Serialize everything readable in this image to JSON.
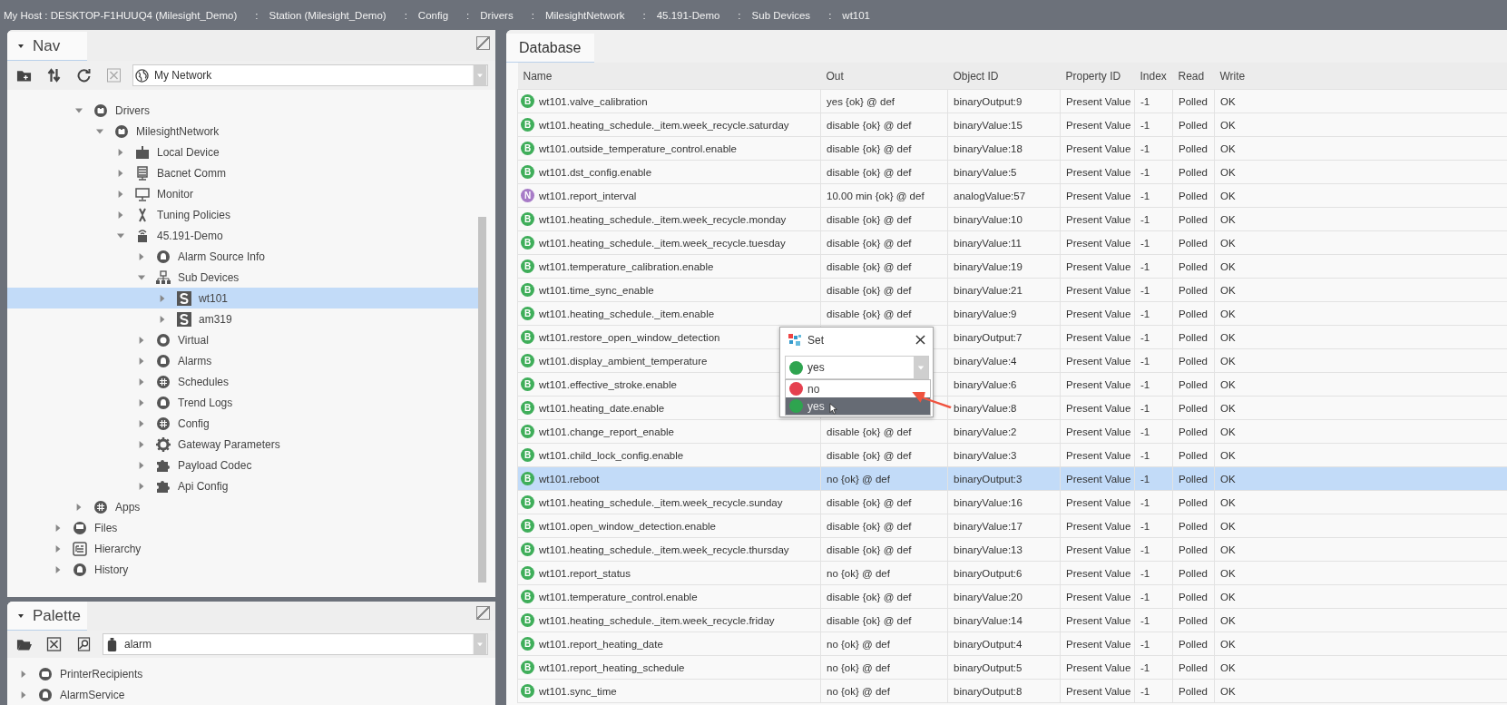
{
  "breadcrumb": {
    "separator": ":",
    "items": [
      "My Host : DESKTOP-F1HUUQ4 (Milesight_Demo)",
      "Station (Milesight_Demo)",
      "Config",
      "Drivers",
      "MilesightNetwork",
      "45.191-Demo",
      "Sub Devices",
      "wt101"
    ]
  },
  "nav": {
    "title": "Nav",
    "ord": "My Network",
    "tree": {
      "continued": [
        {
          "label": "Drivers",
          "kind": "driver",
          "expanded": true,
          "selected": false,
          "children": [
            {
              "label": "MilesightNetwork",
              "kind": "driver",
              "expanded": true,
              "selected": false,
              "children": [
                {
                  "label": "Local Device",
                  "kind": "device",
                  "expanded": false,
                  "selected": false
                },
                {
                  "label": "Bacnet Comm",
                  "kind": "server",
                  "expanded": false,
                  "selected": false
                },
                {
                  "label": "Monitor",
                  "kind": "monitor",
                  "expanded": false,
                  "selected": false
                },
                {
                  "label": "Tuning Policies",
                  "kind": "tool",
                  "expanded": false,
                  "selected": false
                },
                {
                  "label": "45.191-Demo",
                  "kind": "gateway",
                  "expanded": true,
                  "selected": false,
                  "children": [
                    {
                      "label": "Alarm Source Info",
                      "kind": "alarm",
                      "expanded": false,
                      "selected": false
                    },
                    {
                      "label": "Sub Devices",
                      "kind": "network",
                      "expanded": true,
                      "selected": false,
                      "children": [
                        {
                          "label": "wt101",
                          "kind": "subdevice",
                          "expanded": false,
                          "selected": true
                        },
                        {
                          "label": "am319",
                          "kind": "subdevice",
                          "expanded": false,
                          "selected": false
                        }
                      ]
                    },
                    {
                      "label": "Virtual",
                      "kind": "service",
                      "expanded": false,
                      "selected": false
                    },
                    {
                      "label": "Alarms",
                      "kind": "alarm",
                      "expanded": false,
                      "selected": false
                    },
                    {
                      "label": "Schedules",
                      "kind": "grid",
                      "expanded": false,
                      "selected": false
                    },
                    {
                      "label": "Trend Logs",
                      "kind": "alarm",
                      "expanded": false,
                      "selected": false
                    },
                    {
                      "label": "Config",
                      "kind": "grid",
                      "expanded": false,
                      "selected": false
                    },
                    {
                      "label": "Gateway Parameters",
                      "kind": "gear",
                      "expanded": false,
                      "selected": false
                    },
                    {
                      "label": "Payload Codec",
                      "kind": "puzzle",
                      "expanded": false,
                      "selected": false
                    },
                    {
                      "label": "Api Config",
                      "kind": "puzzle",
                      "expanded": false,
                      "selected": false
                    }
                  ]
                }
              ]
            }
          ]
        },
        {
          "label": "Apps",
          "kind": "grid",
          "expanded": false,
          "selected": false
        }
      ],
      "items": [
        {
          "label": "Files",
          "kind": "drive",
          "expanded": false,
          "selected": false
        },
        {
          "label": "Hierarchy",
          "kind": "list",
          "expanded": false,
          "selected": false
        },
        {
          "label": "History",
          "kind": "alarm",
          "expanded": false,
          "selected": false
        }
      ]
    }
  },
  "palette": {
    "title": "Palette",
    "module": "alarm",
    "items": [
      {
        "label": "PrinterRecipients",
        "kind": "folder",
        "expanded": false
      },
      {
        "label": "AlarmService",
        "kind": "alarm",
        "expanded": false
      }
    ]
  },
  "database": {
    "tab": "Database",
    "columns": [
      "Name",
      "Out",
      "Object ID",
      "Property ID",
      "Index",
      "Read",
      "Write"
    ],
    "rows": [
      {
        "type": "B",
        "color": "#3fae5a",
        "name": "wt101.valve_calibration",
        "out": "yes {ok} @ def",
        "object_id": "binaryOutput:9",
        "property_id": "Present Value",
        "index": "-1",
        "read": "Polled",
        "write": "OK",
        "selected": false
      },
      {
        "type": "B",
        "color": "#3fae5a",
        "name": "wt101.heating_schedule._item.week_recycle.saturday",
        "out": "disable {ok} @ def",
        "object_id": "binaryValue:15",
        "property_id": "Present Value",
        "index": "-1",
        "read": "Polled",
        "write": "OK",
        "selected": false
      },
      {
        "type": "B",
        "color": "#3fae5a",
        "name": "wt101.outside_temperature_control.enable",
        "out": "disable {ok} @ def",
        "object_id": "binaryValue:18",
        "property_id": "Present Value",
        "index": "-1",
        "read": "Polled",
        "write": "OK",
        "selected": false
      },
      {
        "type": "B",
        "color": "#3fae5a",
        "name": "wt101.dst_config.enable",
        "out": "disable {ok} @ def",
        "object_id": "binaryValue:5",
        "property_id": "Present Value",
        "index": "-1",
        "read": "Polled",
        "write": "OK",
        "selected": false
      },
      {
        "type": "N",
        "color": "#a77bc7",
        "name": "wt101.report_interval",
        "out": "10.00 min {ok} @ def",
        "object_id": "analogValue:57",
        "property_id": "Present Value",
        "index": "-1",
        "read": "Polled",
        "write": "OK",
        "selected": false
      },
      {
        "type": "B",
        "color": "#3fae5a",
        "name": "wt101.heating_schedule._item.week_recycle.monday",
        "out": "disable {ok} @ def",
        "object_id": "binaryValue:10",
        "property_id": "Present Value",
        "index": "-1",
        "read": "Polled",
        "write": "OK",
        "selected": false
      },
      {
        "type": "B",
        "color": "#3fae5a",
        "name": "wt101.heating_schedule._item.week_recycle.tuesday",
        "out": "disable {ok} @ def",
        "object_id": "binaryValue:11",
        "property_id": "Present Value",
        "index": "-1",
        "read": "Polled",
        "write": "OK",
        "selected": false
      },
      {
        "type": "B",
        "color": "#3fae5a",
        "name": "wt101.temperature_calibration.enable",
        "out": "disable {ok} @ def",
        "object_id": "binaryValue:19",
        "property_id": "Present Value",
        "index": "-1",
        "read": "Polled",
        "write": "OK",
        "selected": false
      },
      {
        "type": "B",
        "color": "#3fae5a",
        "name": "wt101.time_sync_enable",
        "out": "disable {ok} @ def",
        "object_id": "binaryValue:21",
        "property_id": "Present Value",
        "index": "-1",
        "read": "Polled",
        "write": "OK",
        "selected": false
      },
      {
        "type": "B",
        "color": "#3fae5a",
        "name": "wt101.heating_schedule._item.enable",
        "out": "disable {ok} @ def",
        "object_id": "binaryValue:9",
        "property_id": "Present Value",
        "index": "-1",
        "read": "Polled",
        "write": "OK",
        "selected": false
      },
      {
        "type": "B",
        "color": "#3fae5a",
        "name": "wt101.restore_open_window_detection",
        "object_id": "binaryOutput:7",
        "property_id": "Present Value",
        "index": "-1",
        "read": "Polled",
        "write": "OK",
        "selected": false
      },
      {
        "type": "B",
        "color": "#3fae5a",
        "name": "wt101.display_ambient_temperature",
        "object_id": "binaryValue:4",
        "property_id": "Present Value",
        "index": "-1",
        "read": "Polled",
        "write": "OK",
        "selected": false
      },
      {
        "type": "B",
        "color": "#3fae5a",
        "name": "wt101.effective_stroke.enable",
        "object_id": "binaryValue:6",
        "property_id": "Present Value",
        "index": "-1",
        "read": "Polled",
        "write": "OK",
        "selected": false
      },
      {
        "type": "B",
        "color": "#3fae5a",
        "name": "wt101.heating_date.enable",
        "object_id": "binaryValue:8",
        "property_id": "Present Value",
        "index": "-1",
        "read": "Polled",
        "write": "OK",
        "selected": false
      },
      {
        "type": "B",
        "color": "#3fae5a",
        "name": "wt101.change_report_enable",
        "out": "disable {ok} @ def",
        "object_id": "binaryValue:2",
        "property_id": "Present Value",
        "index": "-1",
        "read": "Polled",
        "write": "OK",
        "selected": false
      },
      {
        "type": "B",
        "color": "#3fae5a",
        "name": "wt101.child_lock_config.enable",
        "out": "disable {ok} @ def",
        "object_id": "binaryValue:3",
        "property_id": "Present Value",
        "index": "-1",
        "read": "Polled",
        "write": "OK",
        "selected": false
      },
      {
        "type": "B",
        "color": "#3fae5a",
        "name": "wt101.reboot",
        "out": "no {ok} @ def",
        "object_id": "binaryOutput:3",
        "property_id": "Present Value",
        "index": "-1",
        "read": "Polled",
        "write": "OK",
        "selected": true
      },
      {
        "type": "B",
        "color": "#3fae5a",
        "name": "wt101.heating_schedule._item.week_recycle.sunday",
        "out": "disable {ok} @ def",
        "object_id": "binaryValue:16",
        "property_id": "Present Value",
        "index": "-1",
        "read": "Polled",
        "write": "OK",
        "selected": false
      },
      {
        "type": "B",
        "color": "#3fae5a",
        "name": "wt101.open_window_detection.enable",
        "out": "disable {ok} @ def",
        "object_id": "binaryValue:17",
        "property_id": "Present Value",
        "index": "-1",
        "read": "Polled",
        "write": "OK",
        "selected": false
      },
      {
        "type": "B",
        "color": "#3fae5a",
        "name": "wt101.heating_schedule._item.week_recycle.thursday",
        "out": "disable {ok} @ def",
        "object_id": "binaryValue:13",
        "property_id": "Present Value",
        "index": "-1",
        "read": "Polled",
        "write": "OK",
        "selected": false
      },
      {
        "type": "B",
        "color": "#3fae5a",
        "name": "wt101.report_status",
        "out": "no {ok} @ def",
        "object_id": "binaryOutput:6",
        "property_id": "Present Value",
        "index": "-1",
        "read": "Polled",
        "write": "OK",
        "selected": false
      },
      {
        "type": "B",
        "color": "#3fae5a",
        "name": "wt101.temperature_control.enable",
        "out": "disable {ok} @ def",
        "object_id": "binaryValue:20",
        "property_id": "Present Value",
        "index": "-1",
        "read": "Polled",
        "write": "OK",
        "selected": false
      },
      {
        "type": "B",
        "color": "#3fae5a",
        "name": "wt101.heating_schedule._item.week_recycle.friday",
        "out": "disable {ok} @ def",
        "object_id": "binaryValue:14",
        "property_id": "Present Value",
        "index": "-1",
        "read": "Polled",
        "write": "OK",
        "selected": false
      },
      {
        "type": "B",
        "color": "#3fae5a",
        "name": "wt101.report_heating_date",
        "out": "no {ok} @ def",
        "object_id": "binaryOutput:4",
        "property_id": "Present Value",
        "index": "-1",
        "read": "Polled",
        "write": "OK",
        "selected": false
      },
      {
        "type": "B",
        "color": "#3fae5a",
        "name": "wt101.report_heating_schedule",
        "out": "no {ok} @ def",
        "object_id": "binaryOutput:5",
        "property_id": "Present Value",
        "index": "-1",
        "read": "Polled",
        "write": "OK",
        "selected": false
      },
      {
        "type": "B",
        "color": "#3fae5a",
        "name": "wt101.sync_time",
        "out": "no {ok} @ def",
        "object_id": "binaryOutput:8",
        "property_id": "Present Value",
        "index": "-1",
        "read": "Polled",
        "write": "OK",
        "selected": false
      }
    ]
  },
  "set_dialog": {
    "title": "Set",
    "value": {
      "label": "yes",
      "color": "#2ea44f"
    },
    "options": [
      {
        "label": "no",
        "color": "#e5404f",
        "selected": false
      },
      {
        "label": "yes",
        "color": "#2ea44f",
        "selected": true
      }
    ]
  }
}
